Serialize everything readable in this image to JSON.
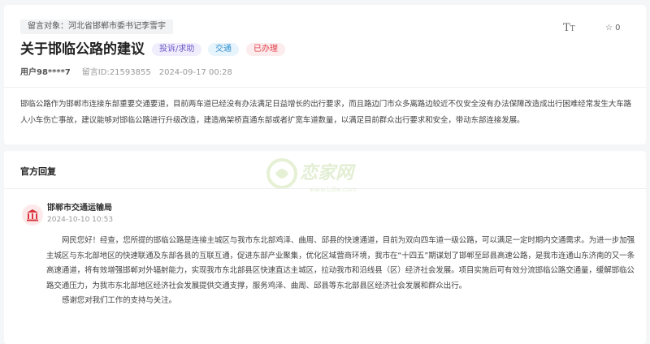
{
  "message": {
    "target_label": "留言对象：河北省邯郸市委书记李雪宇",
    "title": "关于邯临公路的建议",
    "tags": {
      "category": "投诉/求助",
      "topic": "交通",
      "status": "已办理"
    },
    "toolbar": {
      "font_size_icon": "font-size-icon",
      "favorite_icon": "star-icon",
      "favorite_count": "0"
    },
    "user": "用户98****7",
    "message_id": "留言ID:21593855",
    "datetime": "2024-09-17 00:28",
    "content": "邯临公路作为邯郸市连接东部重要交通要道，目前两车道已经没有办法满足日益增长的出行要求，而且路边门市众多离路边较近不仅安全没有办法保障改造成出行困难经常发生大车路人小车伤亡事故，建议能够对邯临公路进行升级改造，建造高架桥直通东部或者扩宽车道数量，以满足目前群众出行要求和安全，带动东部连接发展。"
  },
  "reply": {
    "heading": "官方回复",
    "watermark_text": "恋家网",
    "watermark_url": "www.Lj0a.com",
    "org_icon": "government-building-icon",
    "org_name": "邯郸市交通运输局",
    "date": "2024-10-10 10:53",
    "paragraphs": [
      "网民您好！经查，您所提的邯临公路是连接主城区与我市东北部鸡泽、曲周、邱县的快速通道，目前为双向四车道一级公路，可以满足一定时期内交通需求。为进一步加强主城区与东北部地区的快速联通及东部各县的互联互通，促进东部产业聚集，优化区域营商环境，我市在“十四五”期谋划了邯郸至邱县高速公路，是我市连通山东济南的又一条高速通道，将有效增强邯郸对外辐射能力，实现我市东北部县区快速直达主城区，拉动我市和沿线县（区）经济社会发展。项目实施后可有效分流邯临公路交通量，缓解邯临公路交通压力，为我市东北部地区经济社会发展提供交通支撑，服务鸡泽、曲周、邱县等东北部县区经济社会发展和群众出行。",
      "感谢您对我们工作的支持与关注。"
    ]
  },
  "colors": {
    "page_bg": "#f5f6f8",
    "status_red": "#e0404a",
    "topic_blue": "#2f8fd0",
    "category_purple": "#6e57c8",
    "org_icon_red": "#d9363e"
  }
}
